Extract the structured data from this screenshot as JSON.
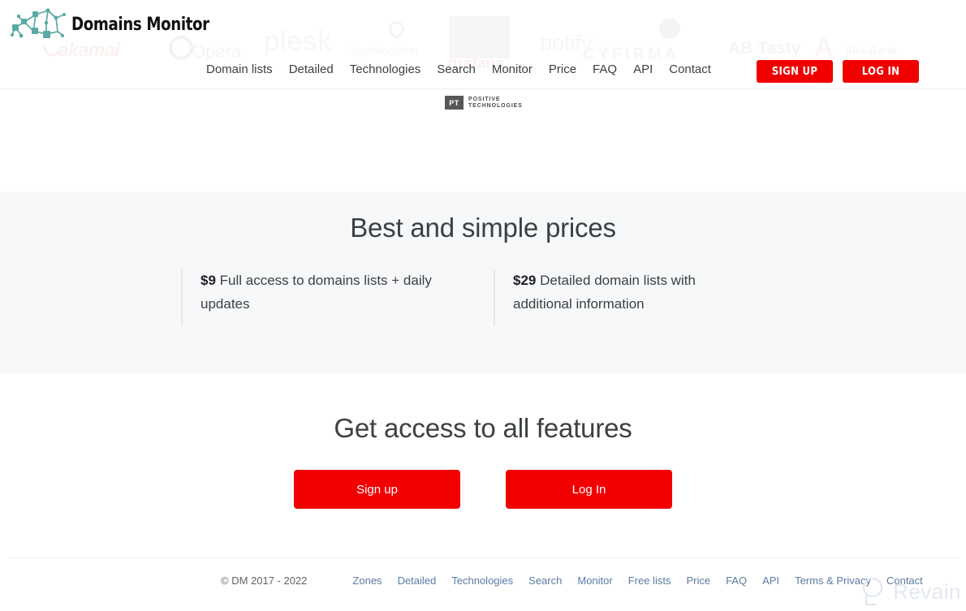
{
  "brand": {
    "logo_text": "Domains Monitor",
    "logo_icon": "network-graph-icon",
    "accent_color": "#f20000",
    "logo_mark_color": "#5aa9a4"
  },
  "header": {
    "nav": [
      {
        "label": "Domain lists"
      },
      {
        "label": "Detailed"
      },
      {
        "label": "Technologies"
      },
      {
        "label": "Search"
      },
      {
        "label": "Monitor"
      },
      {
        "label": "Price"
      },
      {
        "label": "FAQ"
      },
      {
        "label": "API"
      },
      {
        "label": "Contact"
      }
    ],
    "sign_up_label": "SIGN UP",
    "log_in_label": "LOG IN",
    "partner_watermarks": [
      {
        "label": "akamai"
      },
      {
        "label": "Opera"
      },
      {
        "label": "plesk"
      },
      {
        "label": "Ipgeolocation"
      },
      {
        "label": "grafana"
      },
      {
        "label": "botify"
      },
      {
        "label": "CYFIRMA"
      },
      {
        "label": "AB Tasty"
      },
      {
        "label": "Alfa Bank"
      },
      {
        "label": "A"
      }
    ]
  },
  "partner_strip": {
    "pt_mark": "PT",
    "pt_line1": "POSITIVE",
    "pt_line2": "TECHNOLOGIES"
  },
  "pricing": {
    "title": "Best and simple prices",
    "items": [
      {
        "amount": "$9",
        "description": " Full access to domains lists + daily updates"
      },
      {
        "amount": "$29",
        "description": " Detailed domain lists with additional information"
      }
    ]
  },
  "cta": {
    "title": "Get access to all features",
    "sign_up_label": "Sign up",
    "log_in_label": "Log In"
  },
  "footer": {
    "copyright": "© DM 2017 - 2022",
    "links": [
      {
        "label": "Zones"
      },
      {
        "label": "Detailed"
      },
      {
        "label": "Technologies"
      },
      {
        "label": "Search"
      },
      {
        "label": "Monitor"
      },
      {
        "label": "Free lists"
      },
      {
        "label": "Price"
      },
      {
        "label": "FAQ"
      },
      {
        "label": "API"
      },
      {
        "label": "Terms & Privacy"
      },
      {
        "label": "Contact"
      }
    ]
  },
  "watermark": {
    "label": "Revain",
    "icon": "magnifier-icon"
  }
}
